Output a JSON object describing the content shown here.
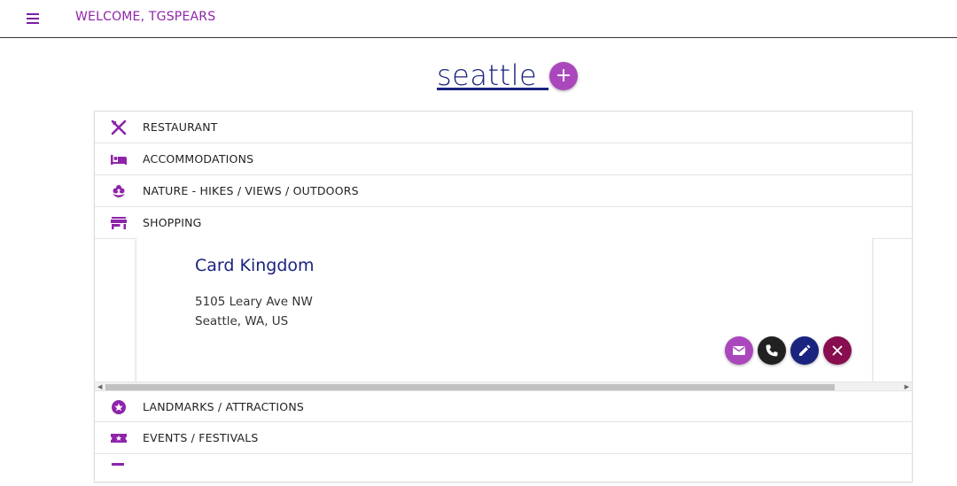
{
  "header": {
    "welcome_text": "WELCOME, TGSPEARS",
    "menu_icon": "hamburger-menu-icon"
  },
  "city": {
    "title": "seattle",
    "add_button_label": "+"
  },
  "categories_top": [
    {
      "label": "RESTAURANT",
      "icon": "utensils-icon"
    },
    {
      "label": "ACCOMMODATIONS",
      "icon": "bed-icon"
    },
    {
      "label": "NATURE - HIKES / VIEWS / OUTDOORS",
      "icon": "flower-icon"
    },
    {
      "label": "SHOPPING",
      "icon": "store-icon"
    }
  ],
  "place": {
    "name": "Card Kingdom",
    "address_line1": "5105 Leary Ave NW",
    "address_line2": "Seattle, WA, US"
  },
  "actions": [
    {
      "name": "email",
      "icon": "mail-icon",
      "color": "#ab47bc"
    },
    {
      "name": "phone",
      "icon": "phone-icon",
      "color": "#212121"
    },
    {
      "name": "edit",
      "icon": "pencil-icon",
      "color": "#1a237e"
    },
    {
      "name": "delete",
      "icon": "close-icon",
      "color": "#880e4f"
    }
  ],
  "categories_bottom": [
    {
      "label": "LANDMARKS / ATTRACTIONS",
      "icon": "star-circle-icon"
    },
    {
      "label": "EVENTS / FESTIVALS",
      "icon": "ticket-icon"
    }
  ],
  "colors": {
    "accent_purple": "#8e24aa",
    "navy": "#1a237e"
  }
}
